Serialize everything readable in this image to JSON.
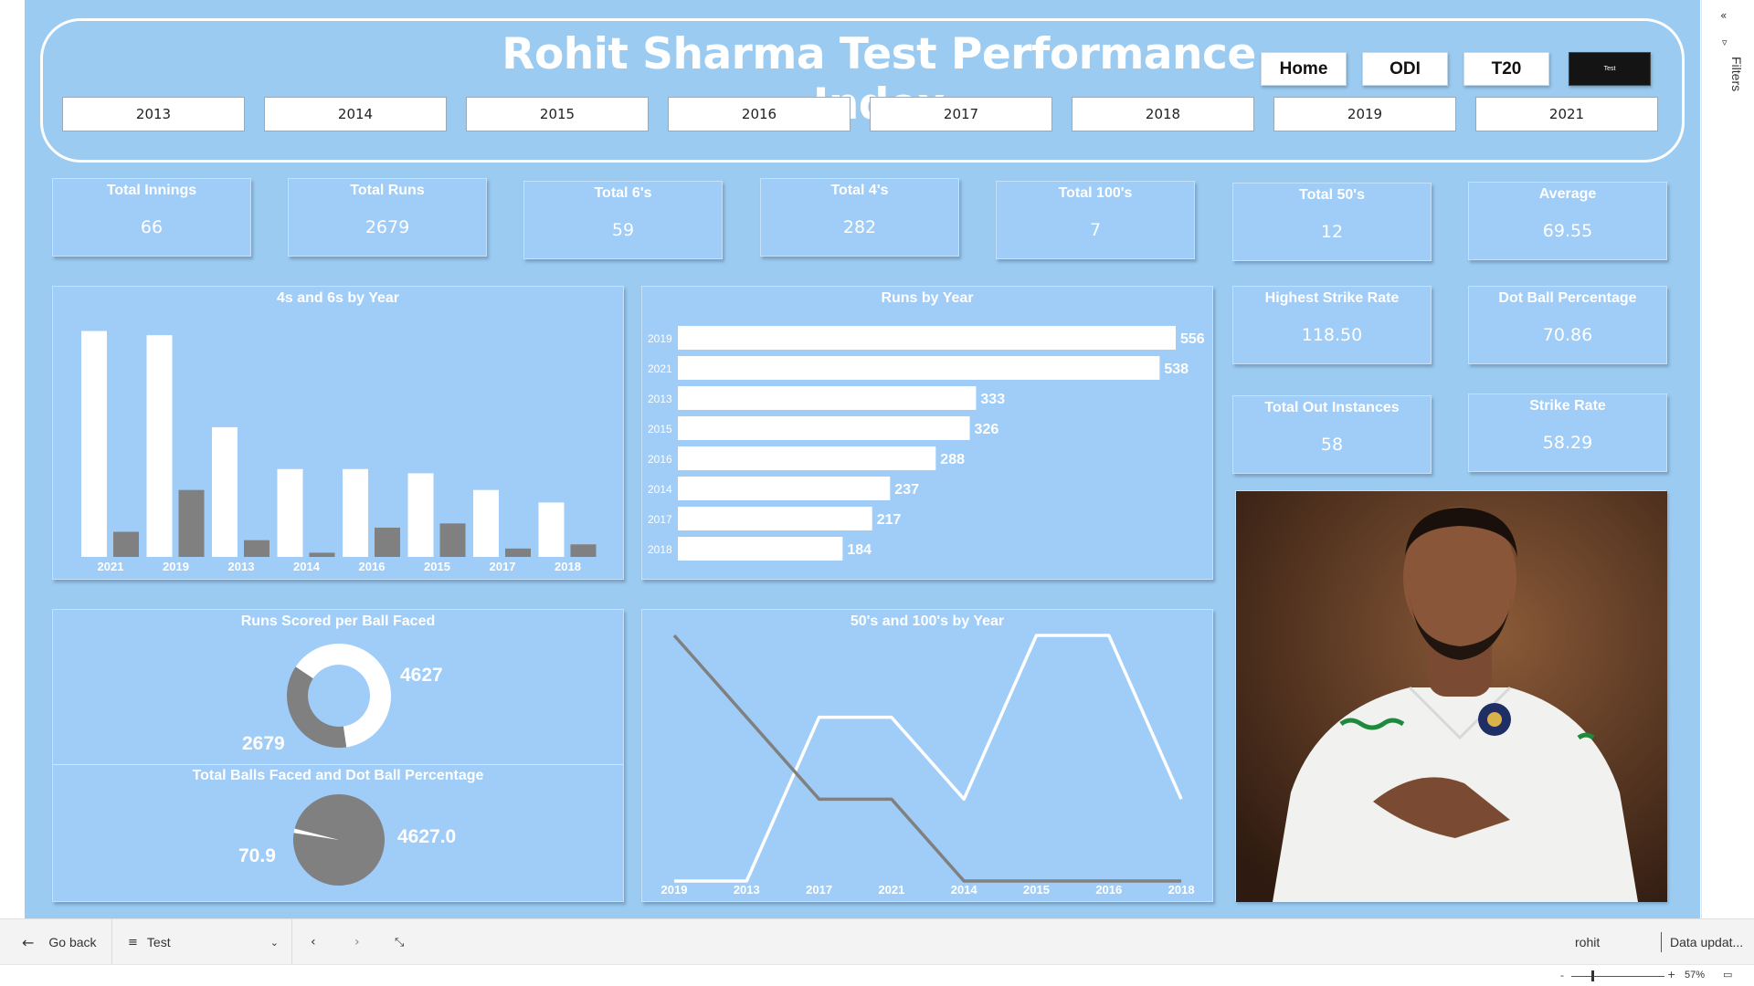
{
  "title": "Rohit Sharma Test Performance Index",
  "nav": {
    "home": "Home",
    "odi": "ODI",
    "t20": "T20",
    "test": "Test"
  },
  "years": [
    "2013",
    "2014",
    "2015",
    "2016",
    "2017",
    "2018",
    "2019",
    "2021"
  ],
  "kpis": {
    "innings": {
      "label": "Total Innings",
      "value": "66"
    },
    "runs": {
      "label": "Total Runs",
      "value": "2679"
    },
    "sixes": {
      "label": "Total 6's",
      "value": "59"
    },
    "fours": {
      "label": "Total 4's",
      "value": "282"
    },
    "hundreds": {
      "label": "Total 100's",
      "value": "7"
    },
    "fifties": {
      "label": "Total 50's",
      "value": "12"
    },
    "average": {
      "label": "Average",
      "value": "69.55"
    },
    "highest_sr": {
      "label": "Highest Strike Rate",
      "value": "118.50"
    },
    "dot_pct": {
      "label": "Dot Ball Percentage",
      "value": "70.86"
    },
    "outs": {
      "label": "Total Out Instances",
      "value": "58"
    },
    "strike_rate": {
      "label": "Strike Rate",
      "value": "58.29"
    }
  },
  "chart_data": [
    {
      "type": "bar",
      "title": "4s and 6s by Year",
      "categories": [
        "2021",
        "2019",
        "2013",
        "2014",
        "2016",
        "2015",
        "2017",
        "2018"
      ],
      "series": [
        {
          "values": [
            54,
            53,
            31,
            21,
            21,
            20,
            16,
            13
          ],
          "color": "#ffffff"
        },
        {
          "values": [
            6,
            16,
            4,
            1,
            7,
            8,
            2,
            3
          ],
          "color": "#808080"
        }
      ]
    },
    {
      "type": "bar",
      "orientation": "horizontal",
      "title": "Runs by Year",
      "categories": [
        "2019",
        "2021",
        "2013",
        "2015",
        "2016",
        "2014",
        "2017",
        "2018"
      ],
      "values": [
        556,
        538,
        333,
        326,
        288,
        237,
        217,
        184
      ],
      "labels": [
        "556",
        "538",
        "333",
        "326",
        "288",
        "237",
        "217",
        "184"
      ]
    },
    {
      "type": "pie",
      "variant": "donut",
      "title": "Runs Scored per Ball Faced",
      "slices": [
        {
          "value": 4627,
          "label": "4627",
          "color": "#ffffff"
        },
        {
          "value": 2679,
          "label": "2679",
          "color": "#808080"
        }
      ]
    },
    {
      "type": "pie",
      "title": "Total Balls Faced and Dot Ball Percentage",
      "slices": [
        {
          "value": 4627.0,
          "label": "4627.0",
          "color": "#808080"
        },
        {
          "value": 70.9,
          "label": "70.9",
          "color": "#ffffff"
        }
      ]
    },
    {
      "type": "line",
      "title": "50's and 100's by Year",
      "categories": [
        "2019",
        "2013",
        "2017",
        "2021",
        "2014",
        "2015",
        "2016",
        "2018"
      ],
      "series": [
        {
          "values": [
            0,
            0,
            2,
            2,
            1,
            3,
            3,
            1
          ],
          "color": "#ffffff"
        },
        {
          "values": [
            3,
            2,
            1,
            1,
            0,
            0,
            0,
            0
          ],
          "color": "#808080"
        }
      ]
    }
  ],
  "bottom": {
    "go_back": "Go back",
    "page_select": "Test",
    "user": "rohit",
    "data_updated": "Data updat...",
    "zoom": "57%",
    "filters": "Filters"
  }
}
